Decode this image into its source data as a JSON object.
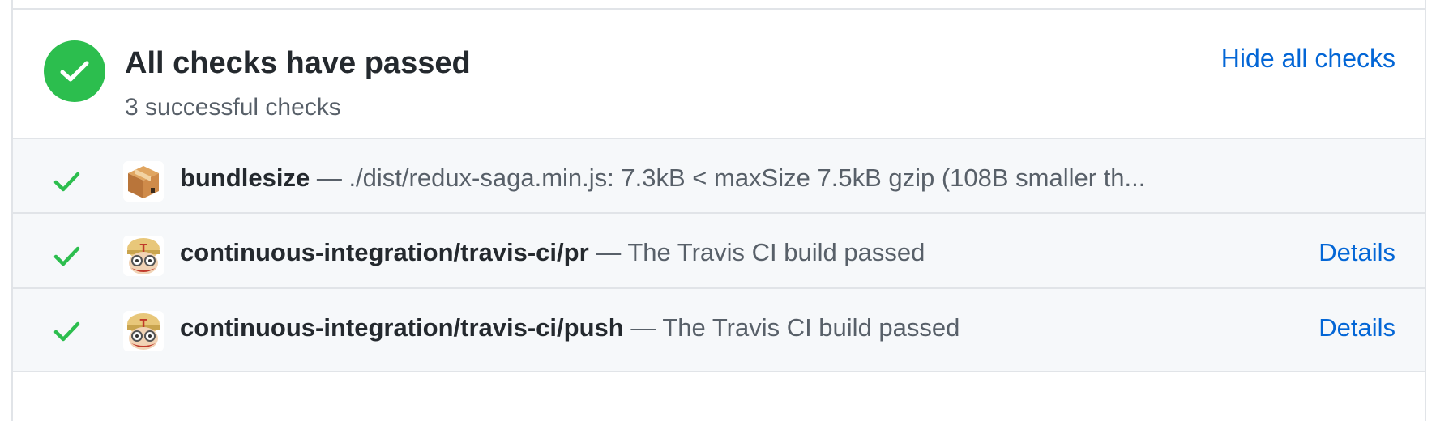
{
  "summary": {
    "title": "All checks have passed",
    "subtitle": "3 successful checks",
    "toggle_label": "Hide all checks",
    "status_color": "#2cbe4e"
  },
  "checks": [
    {
      "name": "bundlesize",
      "separator": " — ",
      "description": "./dist/redux-saga.min.js: 7.3kB < maxSize 7.5kB gzip (108B smaller th...",
      "avatar_icon": "package-box-icon",
      "status_icon": "check-icon",
      "details_label": ""
    },
    {
      "name": "continuous-integration/travis-ci/pr",
      "separator": " — ",
      "description": "The Travis CI build passed",
      "avatar_icon": "travis-ci-mascot-icon",
      "status_icon": "check-icon",
      "details_label": "Details"
    },
    {
      "name": "continuous-integration/travis-ci/push",
      "separator": " — ",
      "description": "The Travis CI build passed",
      "avatar_icon": "travis-ci-mascot-icon",
      "status_icon": "check-icon",
      "details_label": "Details"
    }
  ],
  "colors": {
    "success": "#2cbe4e",
    "link": "#0366d6",
    "row_bg": "#f6f8fa",
    "border": "#e1e4e8"
  }
}
